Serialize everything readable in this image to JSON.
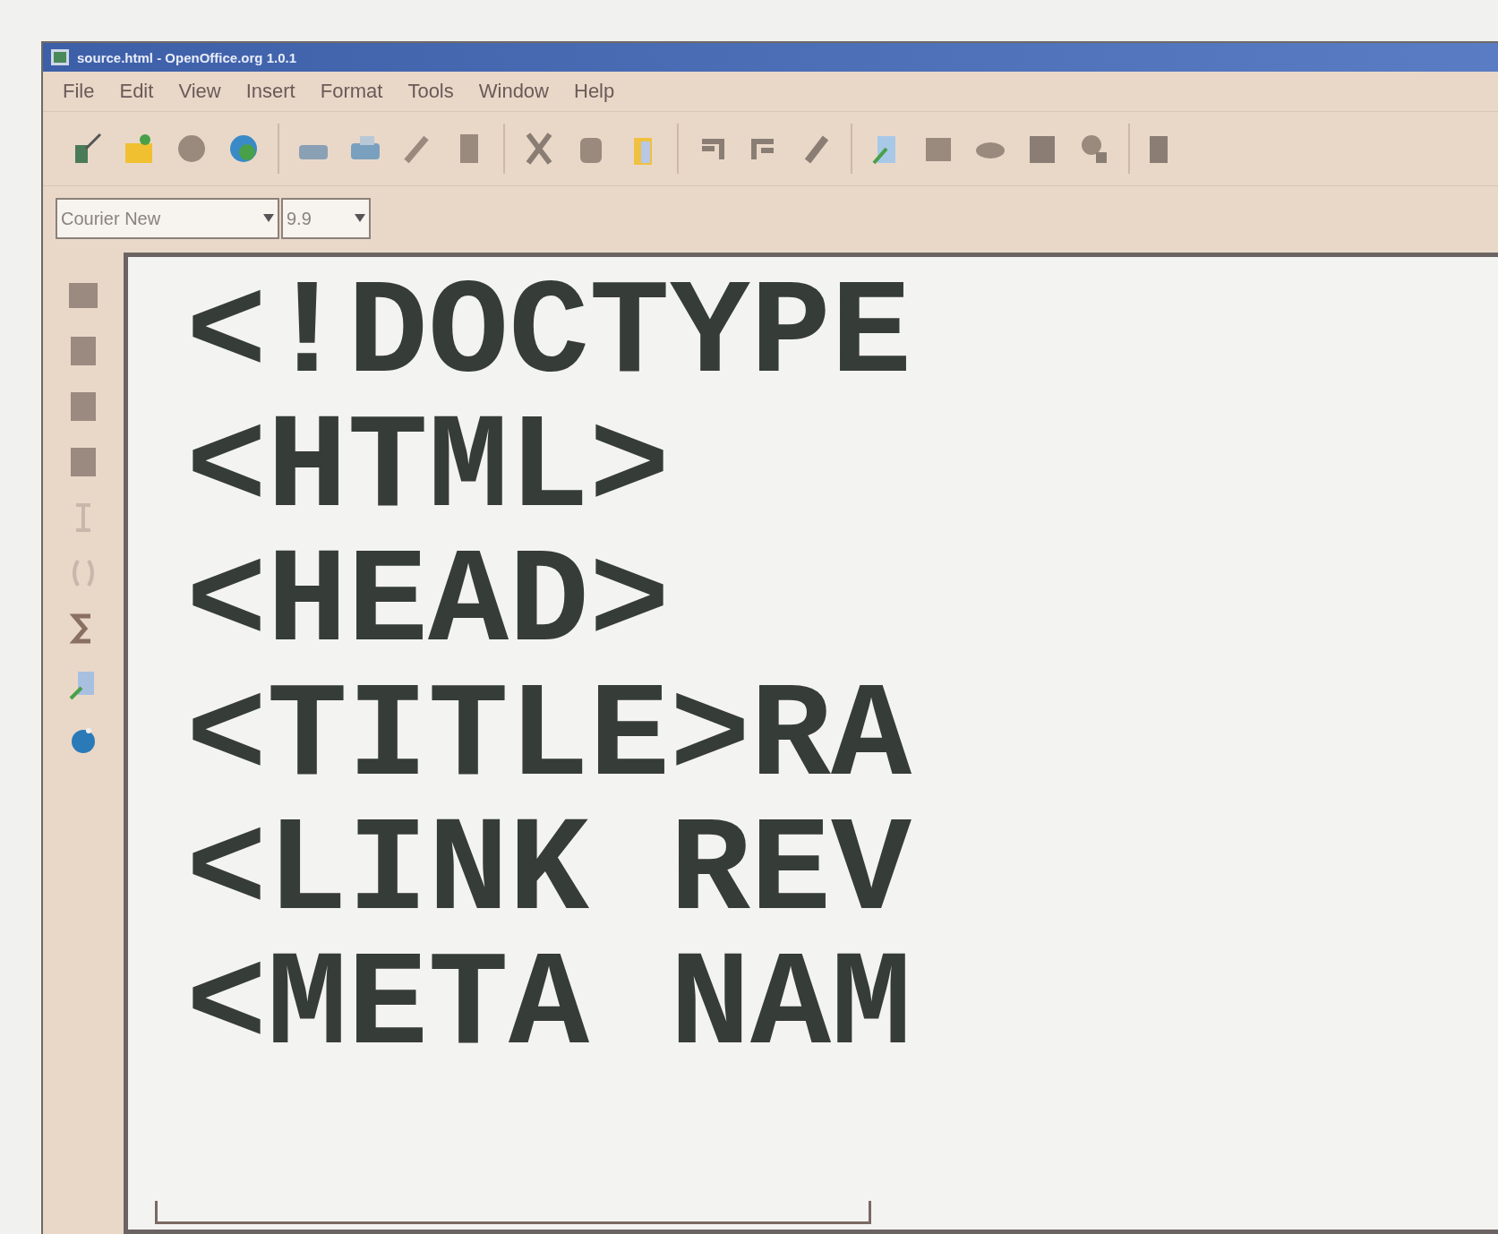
{
  "window": {
    "title": "source.html - OpenOffice.org 1.0.1"
  },
  "menu": [
    "File",
    "Edit",
    "View",
    "Insert",
    "Format",
    "Tools",
    "Window",
    "Help"
  ],
  "font_bar": {
    "font_name": "Courier New",
    "font_size": "9.9"
  },
  "document": {
    "lines": [
      "<!DOCTYPE",
      "<HTML>",
      "<HEAD>",
      "<TITLE>RA",
      "<LINK REV",
      "<META NAM"
    ]
  }
}
